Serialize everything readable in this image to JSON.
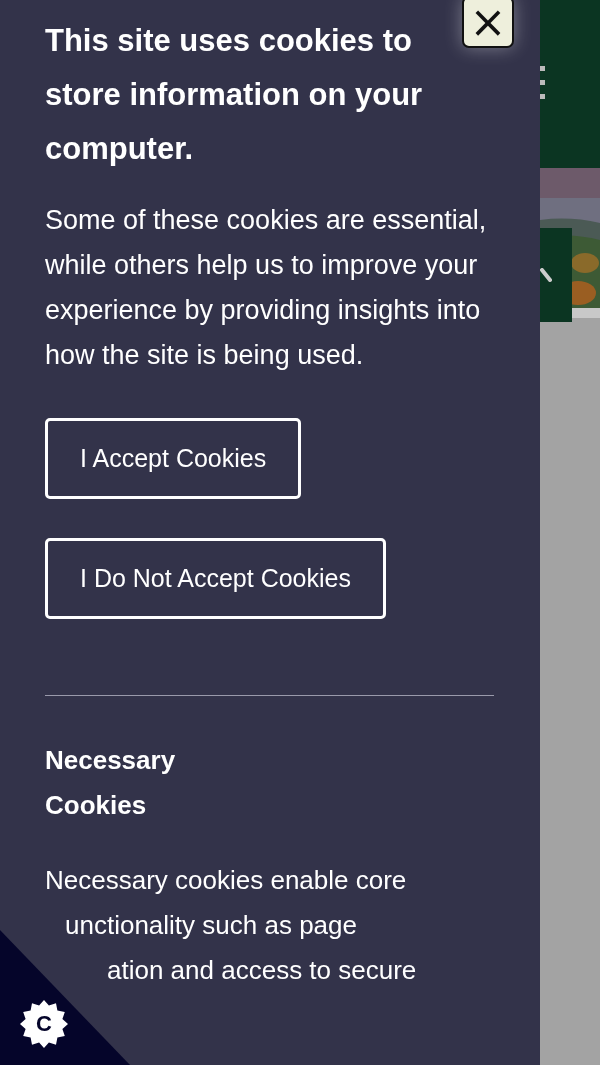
{
  "close_button": {
    "label": "×"
  },
  "banner": {
    "title": "This site uses cookies to store information on your computer.",
    "intro": "Some of these cookies are essential, while others help us to improve your experience by providing insights into how the site is being used.",
    "buttons": [
      {
        "label": "I Accept Cookies"
      },
      {
        "label": "I Do Not Accept Cookies"
      }
    ],
    "sections": [
      {
        "heading": "Necessary Cookies",
        "text_lines": [
          "Necessary cookies enable core",
          "unctionality such as page",
          "ation and access to secure"
        ]
      }
    ]
  },
  "cookie_badge": {
    "label": "C"
  }
}
